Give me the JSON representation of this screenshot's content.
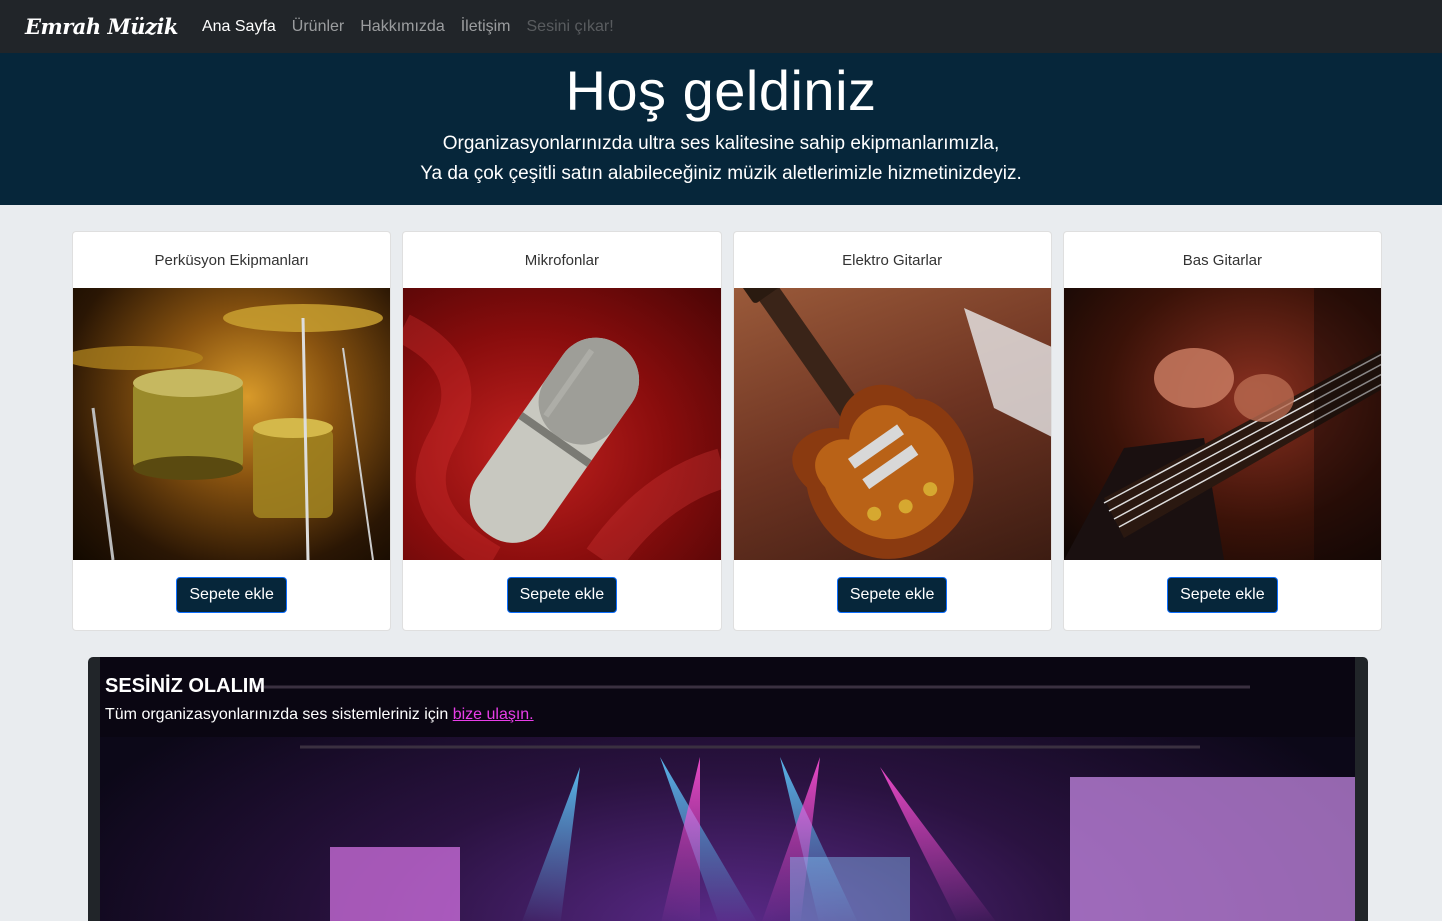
{
  "navbar": {
    "brand": "Emrah Müzik",
    "links": [
      {
        "label": "Ana Sayfa",
        "state": "active"
      },
      {
        "label": "Ürünler",
        "state": "normal"
      },
      {
        "label": "Hakkımızda",
        "state": "normal"
      },
      {
        "label": "İletişim",
        "state": "normal"
      },
      {
        "label": "Sesini çıkar!",
        "state": "disabled"
      }
    ]
  },
  "hero": {
    "title": "Hoş geldiniz",
    "line1": "Organizasyonlarınızda ultra ses kalitesine sahip ekipmanlarımızla,",
    "line2": "Ya da çok çeşitli satın alabileceğiniz müzik aletlerimizle hizmetinizdeyiz."
  },
  "cards": [
    {
      "title": "Perküsyon Ekipmanları",
      "button": "Sepete ekle",
      "image": "drums-photo"
    },
    {
      "title": "Mikrofonlar",
      "button": "Sepete ekle",
      "image": "microphone-photo"
    },
    {
      "title": "Elektro Gitarlar",
      "button": "Sepete ekle",
      "image": "electric-guitar-photo"
    },
    {
      "title": "Bas Gitarlar",
      "button": "Sepete ekle",
      "image": "bass-guitar-photo"
    }
  ],
  "concert": {
    "heading": "SESİNİZ OLALIM",
    "text": "Tüm organizasyonlarınızda ses sistemleriniz için ",
    "link": "bize ulaşın."
  },
  "colors": {
    "navbar_bg": "#212529",
    "hero_bg": "#06263a",
    "button_bg": "#06263a",
    "link_accent": "#e83ee8"
  }
}
